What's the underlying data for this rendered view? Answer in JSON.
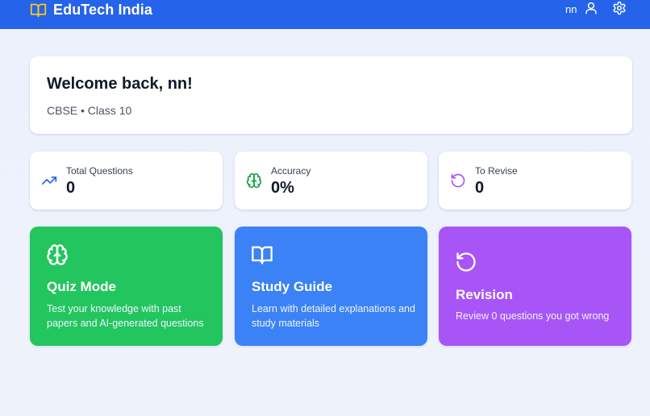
{
  "header": {
    "brand": "EduTech India",
    "brand_icon": "open-book-icon",
    "user_name": "nn",
    "user_icon": "user-icon",
    "settings_icon": "gear-icon",
    "bar_color": "#2563eb"
  },
  "welcome": {
    "title": "Welcome back, nn!",
    "subtitle": "CBSE • Class 10"
  },
  "stats": [
    {
      "label": "Total Questions",
      "value": "0",
      "icon": "trending-up-icon",
      "color": "#2563eb"
    },
    {
      "label": "Accuracy",
      "value": "0%",
      "icon": "brain-icon",
      "color": "#16a34a"
    },
    {
      "label": "To Revise",
      "value": "0",
      "icon": "rotate-ccw-icon",
      "color": "#a855f7"
    }
  ],
  "actions": [
    {
      "title": "Quiz Mode",
      "description": "Test your knowledge with past papers and AI-generated questions",
      "icon": "brain-icon",
      "color": "#22c55e"
    },
    {
      "title": "Study Guide",
      "description": "Learn with detailed explanations and study materials",
      "icon": "open-book-icon",
      "color": "#3b82f6"
    },
    {
      "title": "Revision",
      "description": "Review 0 questions you got wrong",
      "icon": "rotate-ccw-icon",
      "color": "#a855f7"
    }
  ]
}
